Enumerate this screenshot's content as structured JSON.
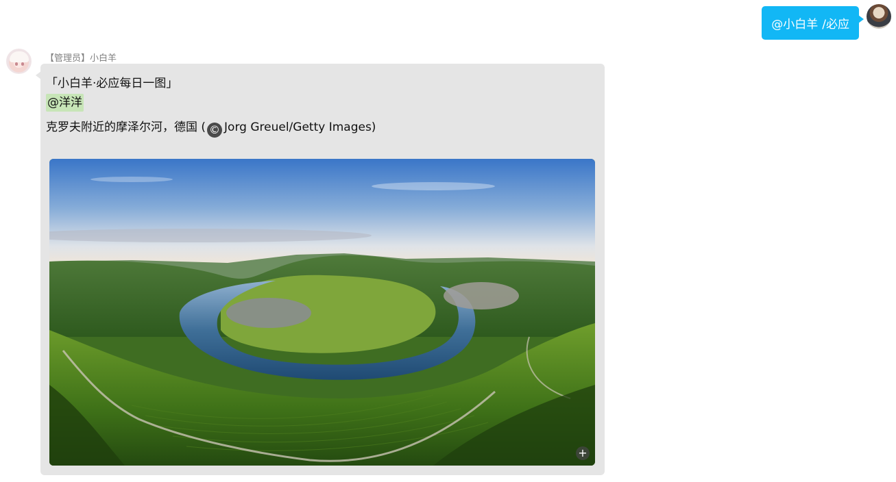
{
  "outgoing": {
    "mention": "@小白羊",
    "command": "/必应"
  },
  "incoming": {
    "sender": "【管理员】小白羊",
    "title_line": "「小白羊·必应每日一图」",
    "mention": "@洋洋",
    "caption": "克罗夫附近的摩泽尔河，德国 (",
    "copyright_symbol": "©",
    "credit": "Jorg Greuel/Getty Images)",
    "expand_symbol": "+"
  },
  "colors": {
    "outgoing_bubble": "#12b7f5",
    "incoming_bubble": "#e5e5e5",
    "mention_highlight": "#c7e5b7"
  },
  "icons": {
    "self_avatar": "user-avatar-icon",
    "bot_avatar": "bot-avatar-icon",
    "copyright": "copyright-icon",
    "expand": "expand-image-icon"
  }
}
